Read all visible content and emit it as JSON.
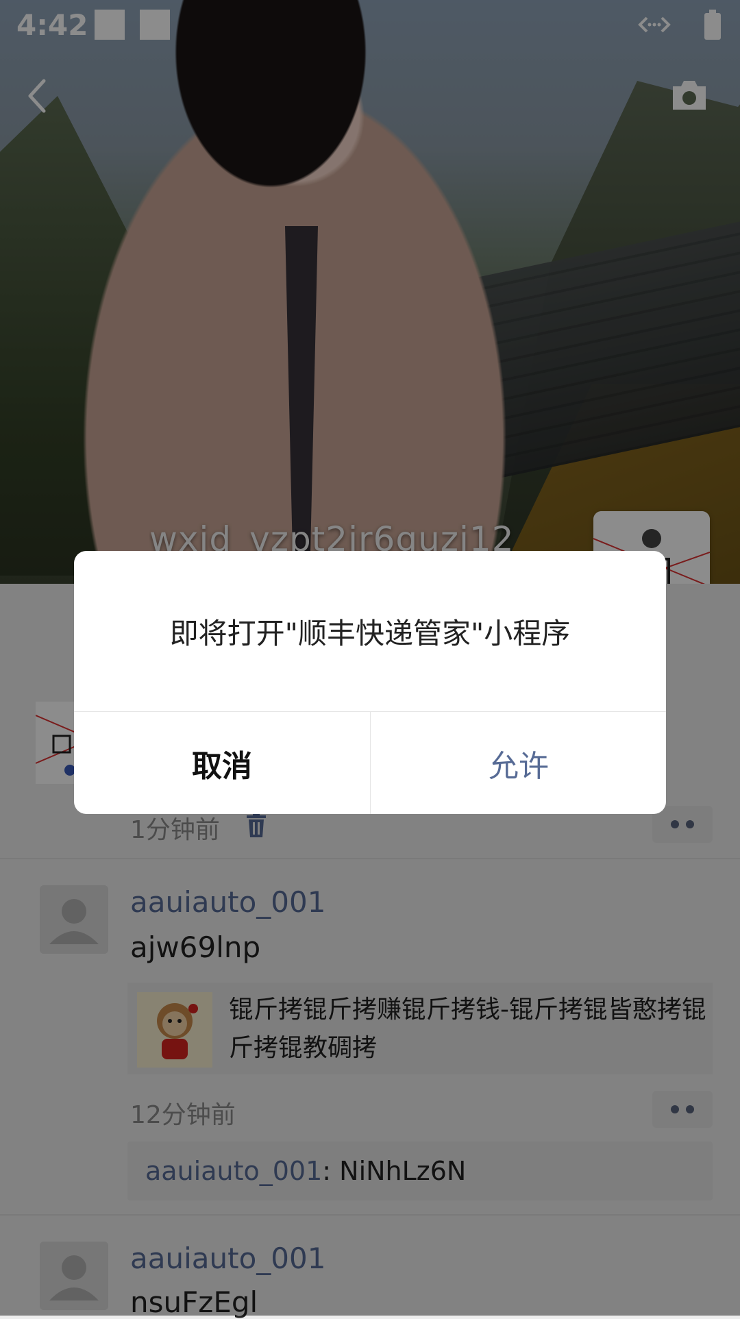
{
  "status_bar": {
    "time": "4:42"
  },
  "profile": {
    "name": "wxid_vzpt2ir6guzi12"
  },
  "posts": [
    {
      "time": "1分钟前"
    },
    {
      "user": "aauiauto_001",
      "text": "ajw69lnp",
      "share_text": "锟斤拷锟斤拷赚锟斤拷钱-锟斤拷锟皆憨拷锟斤拷锟教碉拷",
      "time": "12分钟前",
      "comment": {
        "user": "aauiauto_001",
        "text": ": NiNhLz6N"
      }
    },
    {
      "user": "aauiauto_001",
      "text": "nsuFzEgl"
    }
  ],
  "dialog": {
    "message": "即将打开\"顺丰快递管家\"小程序",
    "cancel_label": "取消",
    "allow_label": "允许"
  },
  "colors": {
    "link": "#576b95",
    "overlay": "rgba(0,0,0,0.45)"
  }
}
